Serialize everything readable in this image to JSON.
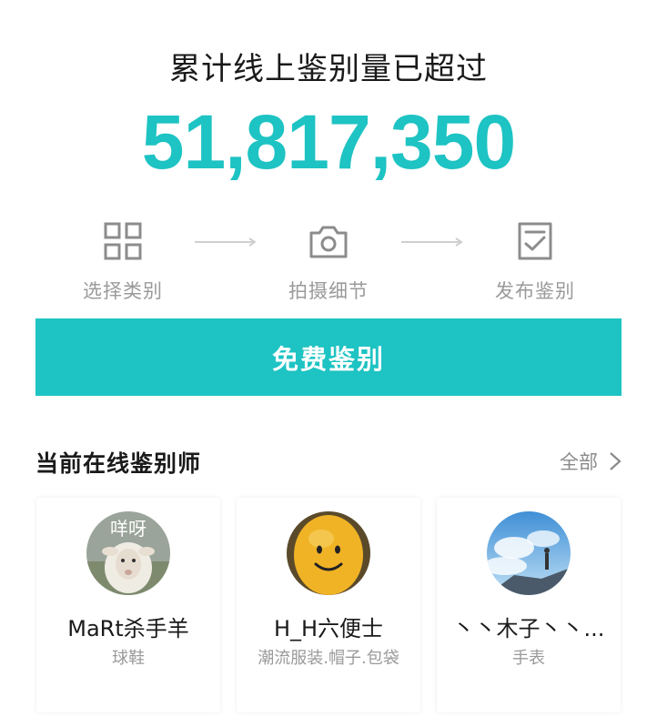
{
  "headline": "累计线上鉴别量已超过",
  "counter": "51,817,350",
  "steps": [
    {
      "label": "选择类别",
      "icon": "category-grid-icon"
    },
    {
      "label": "拍摄细节",
      "icon": "camera-icon"
    },
    {
      "label": "发布鉴别",
      "icon": "checklist-icon"
    }
  ],
  "cta": {
    "label": "免费鉴别"
  },
  "appraisers_section": {
    "title": "当前在线鉴别师",
    "see_all": "全部"
  },
  "appraisers": [
    {
      "name": "MaRt杀手羊",
      "category": "球鞋",
      "avatar_caption": "咩呀",
      "avatar_icon": "sheep-avatar"
    },
    {
      "name": "H_H六便士",
      "category": "潮流服装.帽子.包袋",
      "avatar_icon": "smiley-avatar"
    },
    {
      "name": "丶丶木子丶丶...",
      "category": "手表",
      "avatar_icon": "sky-scene-avatar"
    }
  ],
  "colors": {
    "accent": "#1ec3c3",
    "muted_text": "#9a9a9a",
    "icon_gray": "#8c8c8c"
  }
}
